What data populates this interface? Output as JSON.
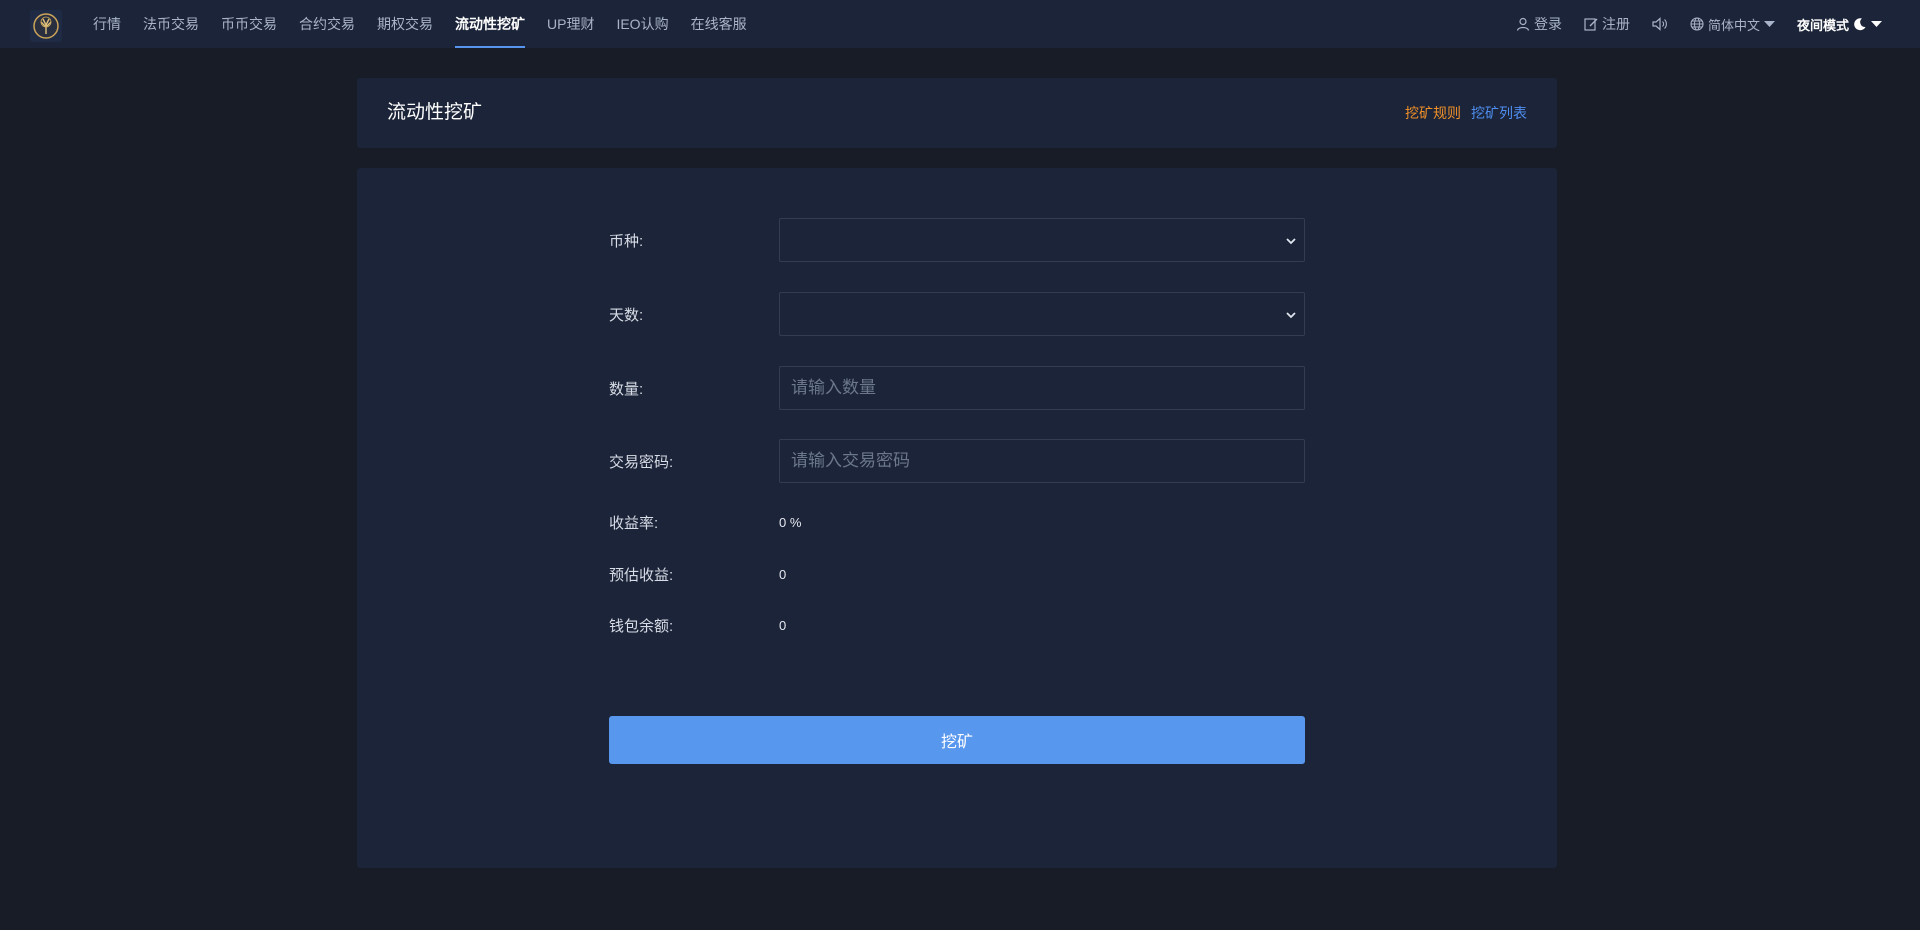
{
  "nav": {
    "items": [
      {
        "label": "行情",
        "active": false
      },
      {
        "label": "法币交易",
        "active": false
      },
      {
        "label": "币币交易",
        "active": false
      },
      {
        "label": "合约交易",
        "active": false
      },
      {
        "label": "期权交易",
        "active": false
      },
      {
        "label": "流动性挖矿",
        "active": true
      },
      {
        "label": "UP理财",
        "active": false
      },
      {
        "label": "IEO认购",
        "active": false
      },
      {
        "label": "在线客服",
        "active": false
      }
    ],
    "login": "登录",
    "register": "注册",
    "language": "简体中文",
    "theme": "夜间模式"
  },
  "header": {
    "title": "流动性挖矿",
    "rules_link": "挖矿规则",
    "list_link": "挖矿列表"
  },
  "form": {
    "currency_label": "币种:",
    "currency_value": "",
    "days_label": "天数:",
    "days_value": "",
    "amount_label": "数量:",
    "amount_placeholder": "请输入数量",
    "password_label": "交易密码:",
    "password_placeholder": "请输入交易密码",
    "yield_label": "收益率:",
    "yield_value": "0 %",
    "estimated_label": "预估收益:",
    "estimated_value": "0",
    "balance_label": "钱包余额:",
    "balance_value": "0",
    "submit_label": "挖矿"
  },
  "colors": {
    "accent": "#5694f0",
    "button": "#5897ee",
    "link_orange": "#f0902a",
    "link_blue": "#4f8ef0",
    "background": "#181c27",
    "panel": "#1b2438"
  },
  "icons": [
    "logo-icon",
    "user-icon",
    "edit-icon",
    "speaker-icon",
    "globe-icon",
    "caret-down-icon",
    "moon-icon",
    "chevron-down-icon"
  ]
}
